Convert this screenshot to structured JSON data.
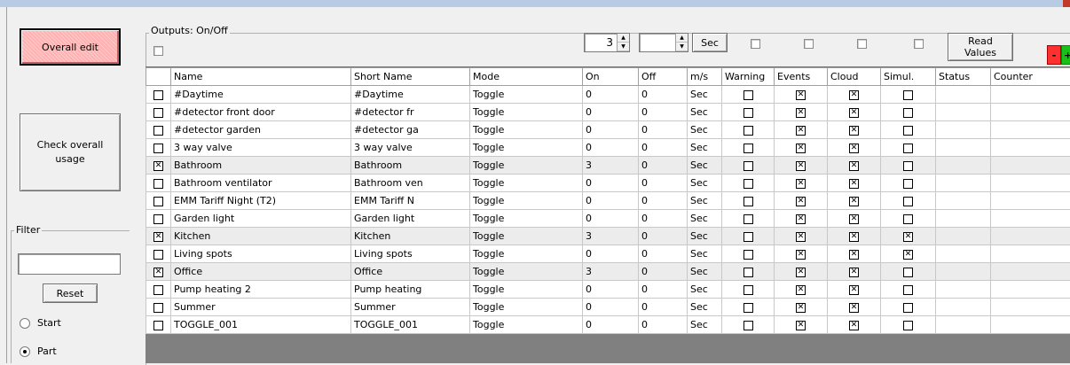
{
  "window": {
    "accent": "#b7cbe4"
  },
  "sidebar": {
    "overall_edit_label": "Overall edit",
    "check_usage_label": "Check overall usage",
    "filter": {
      "legend": "Filter",
      "value": "",
      "reset_label": "Reset"
    },
    "radio_options": [
      {
        "label": "Start",
        "selected": false
      },
      {
        "label": "Part",
        "selected": true
      }
    ]
  },
  "outputs": {
    "legend": "Outputs: On/Off",
    "select_all_checked": false,
    "spin_value_1": "3",
    "spin_value_2": "",
    "sec_label": "Sec",
    "header_checkboxes": [
      false,
      false,
      false,
      false
    ],
    "read_values_label": "Read Values",
    "minus_label": "-",
    "plus_label": "+",
    "minus_color": "#ff3030",
    "plus_color": "#18c018"
  },
  "table": {
    "headers": [
      "",
      "Name",
      "Short Name",
      "Mode",
      "On",
      "Off",
      "m/s",
      "Warning",
      "Events",
      "Cloud",
      "Simul.",
      "Status",
      "Counter"
    ],
    "rows": [
      {
        "sel": false,
        "name": "#Daytime",
        "short": "#Daytime",
        "mode": "Toggle",
        "on": "0",
        "off": "0",
        "ms": "Sec",
        "warning": false,
        "events": true,
        "cloud": true,
        "simul": false,
        "status": "",
        "counter": ""
      },
      {
        "sel": false,
        "name": "#detector front door",
        "short": "#detector fr",
        "mode": "Toggle",
        "on": "0",
        "off": "0",
        "ms": "Sec",
        "warning": false,
        "events": true,
        "cloud": true,
        "simul": false,
        "status": "",
        "counter": ""
      },
      {
        "sel": false,
        "name": "#detector garden",
        "short": "#detector ga",
        "mode": "Toggle",
        "on": "0",
        "off": "0",
        "ms": "Sec",
        "warning": false,
        "events": true,
        "cloud": true,
        "simul": false,
        "status": "",
        "counter": ""
      },
      {
        "sel": false,
        "name": "3 way valve",
        "short": "3 way valve",
        "mode": "Toggle",
        "on": "0",
        "off": "0",
        "ms": "Sec",
        "warning": false,
        "events": true,
        "cloud": true,
        "simul": false,
        "status": "",
        "counter": ""
      },
      {
        "sel": true,
        "name": "Bathroom",
        "short": "Bathroom",
        "mode": "Toggle",
        "on": "3",
        "off": "0",
        "ms": "Sec",
        "warning": false,
        "events": true,
        "cloud": true,
        "simul": false,
        "status": "",
        "counter": ""
      },
      {
        "sel": false,
        "name": "Bathroom ventilator",
        "short": "Bathroom ven",
        "mode": "Toggle",
        "on": "0",
        "off": "0",
        "ms": "Sec",
        "warning": false,
        "events": true,
        "cloud": true,
        "simul": false,
        "status": "",
        "counter": ""
      },
      {
        "sel": false,
        "name": "EMM Tariff Night (T2)",
        "short": "EMM Tariff N",
        "mode": "Toggle",
        "on": "0",
        "off": "0",
        "ms": "Sec",
        "warning": false,
        "events": true,
        "cloud": true,
        "simul": false,
        "status": "",
        "counter": ""
      },
      {
        "sel": false,
        "name": "Garden light",
        "short": "Garden light",
        "mode": "Toggle",
        "on": "0",
        "off": "0",
        "ms": "Sec",
        "warning": false,
        "events": true,
        "cloud": true,
        "simul": false,
        "status": "",
        "counter": ""
      },
      {
        "sel": true,
        "name": "Kitchen",
        "short": "Kitchen",
        "mode": "Toggle",
        "on": "3",
        "off": "0",
        "ms": "Sec",
        "warning": false,
        "events": true,
        "cloud": true,
        "simul": true,
        "status": "",
        "counter": ""
      },
      {
        "sel": false,
        "name": "Living spots",
        "short": "Living spots",
        "mode": "Toggle",
        "on": "0",
        "off": "0",
        "ms": "Sec",
        "warning": false,
        "events": true,
        "cloud": true,
        "simul": true,
        "status": "",
        "counter": ""
      },
      {
        "sel": true,
        "name": "Office",
        "short": "Office",
        "mode": "Toggle",
        "on": "3",
        "off": "0",
        "ms": "Sec",
        "warning": false,
        "events": true,
        "cloud": true,
        "simul": false,
        "status": "",
        "counter": ""
      },
      {
        "sel": false,
        "name": "Pump heating 2",
        "short": "Pump heating",
        "mode": "Toggle",
        "on": "0",
        "off": "0",
        "ms": "Sec",
        "warning": false,
        "events": true,
        "cloud": true,
        "simul": false,
        "status": "",
        "counter": ""
      },
      {
        "sel": false,
        "name": "Summer",
        "short": "Summer",
        "mode": "Toggle",
        "on": "0",
        "off": "0",
        "ms": "Sec",
        "warning": false,
        "events": true,
        "cloud": true,
        "simul": false,
        "status": "",
        "counter": ""
      },
      {
        "sel": false,
        "name": "TOGGLE_001",
        "short": "TOGGLE_001",
        "mode": "Toggle",
        "on": "0",
        "off": "0",
        "ms": "Sec",
        "warning": false,
        "events": true,
        "cloud": true,
        "simul": false,
        "status": "",
        "counter": ""
      }
    ]
  }
}
